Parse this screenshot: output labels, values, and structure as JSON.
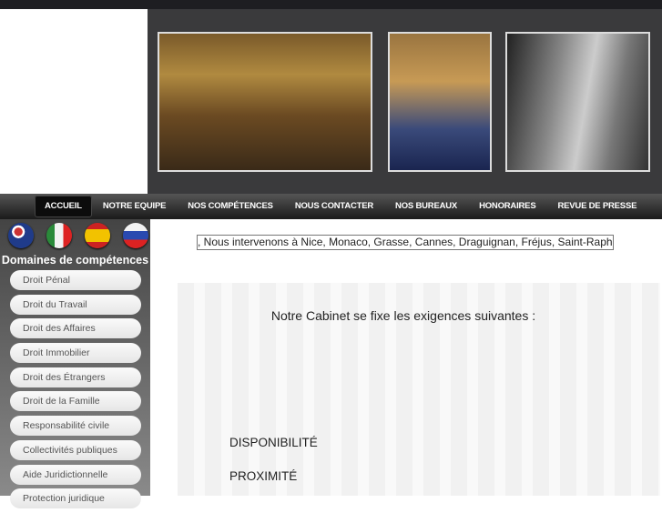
{
  "nav": {
    "items": [
      "ACCUEIL",
      "NOTRE EQUIPE",
      "NOS COMPÉTENCES",
      "NOUS CONTACTER",
      "NOS BUREAUX",
      "HONORAIRES",
      "REVUE DE PRESSE"
    ],
    "active": "ACCUEIL"
  },
  "languages": [
    "English",
    "Italiano",
    "Español",
    "Русский"
  ],
  "sidebar": {
    "title": "Domaines de compétences",
    "items": [
      "Droit Pénal",
      "Droit du Travail",
      "Droit des Affaires",
      "Droit Immobilier",
      "Droit des Étrangers",
      "Droit de la Famille",
      "Responsabilité civile",
      "Collectivités publiques",
      "Aide Juridictionnelle",
      "Protection juridique"
    ]
  },
  "main": {
    "marquee": ", Nous intervenons à Nice, Monaco, Grasse, Cannes, Draguignan, Fréjus, Saint-Raph",
    "intro": "Notre Cabinet se fixe les exigences suivantes :",
    "requirements": [
      "DISPONIBILITÉ",
      "PROXIMITÉ"
    ]
  }
}
